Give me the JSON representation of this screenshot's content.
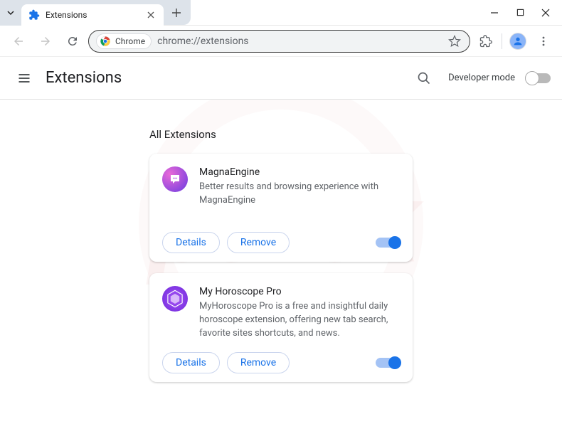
{
  "tab": {
    "title": "Extensions"
  },
  "omnibox": {
    "chip_label": "Chrome",
    "url": "chrome://extensions"
  },
  "header": {
    "title": "Extensions",
    "dev_mode_label": "Developer mode"
  },
  "section": {
    "title": "All Extensions"
  },
  "extensions": [
    {
      "name": "MagnaEngine",
      "description": "Better results and browsing experience with MagnaEngine",
      "details_label": "Details",
      "remove_label": "Remove",
      "enabled": true
    },
    {
      "name": "My Horoscope Pro",
      "description": "MyHoroscope Pro is a free and insightful daily horoscope extension, offering new tab search, favorite sites shortcuts, and news.",
      "details_label": "Details",
      "remove_label": "Remove",
      "enabled": true
    }
  ]
}
